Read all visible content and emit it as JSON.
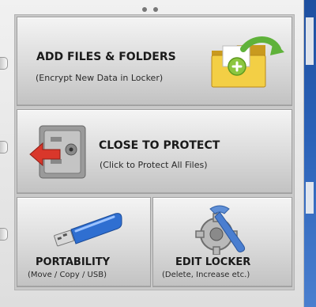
{
  "buttons": {
    "add": {
      "title": "ADD FILES & FOLDERS",
      "subtitle": "(Encrypt New Data in Locker)"
    },
    "close": {
      "title": "CLOSE TO PROTECT",
      "subtitle": "(Click to Protect All Files)"
    },
    "portability": {
      "title": "PORTABILITY",
      "subtitle": "(Move / Copy / USB)"
    },
    "edit": {
      "title": "EDIT LOCKER",
      "subtitle": "(Delete, Increase etc.)"
    }
  },
  "icons": {
    "add": "folder-add-icon",
    "close": "safe-icon",
    "portability": "usb-drive-icon",
    "edit": "gear-wrench-icon"
  },
  "colors": {
    "folder": "#e9c43a",
    "plus": "#8cc63f",
    "arrow_green": "#5fb23a",
    "arrow_red": "#d9372b",
    "usb_blue": "#2f6fd1",
    "desktop_blue": "#2b62b8"
  }
}
